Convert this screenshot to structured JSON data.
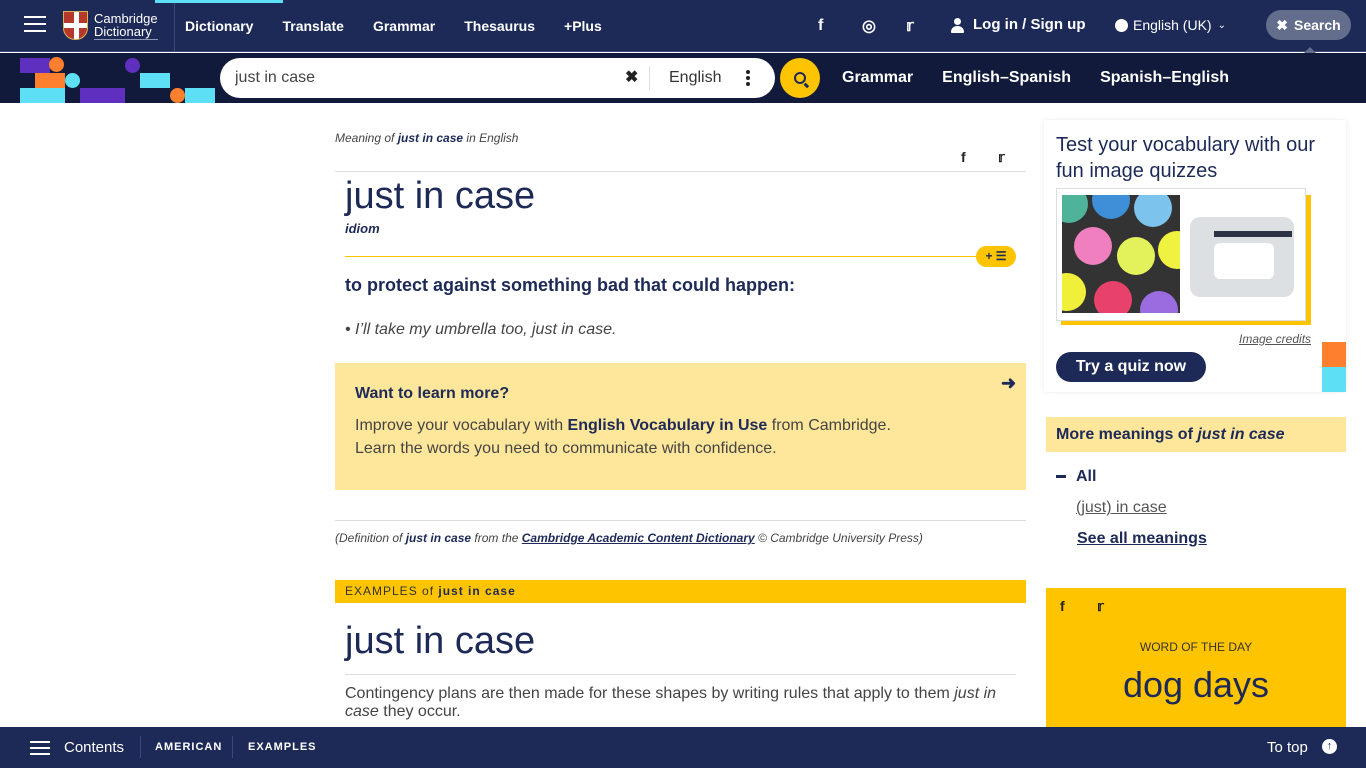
{
  "header": {
    "logo_line1": "Cambridge",
    "logo_line2": "Dictionary",
    "nav": [
      {
        "label": "Dictionary",
        "active": true
      },
      {
        "label": "Translate"
      },
      {
        "label": "Grammar"
      },
      {
        "label": "Thesaurus"
      },
      {
        "label": "+Plus"
      }
    ],
    "social": [
      "facebook-icon",
      "instagram-icon",
      "twitter-icon"
    ],
    "login_label": "Log in / Sign up",
    "language_label": "English (UK)",
    "search_toggle_label": "Search"
  },
  "searchbar": {
    "query": "just in case",
    "dictionary": "English",
    "sub_nav": [
      "Grammar",
      "English–Spanish",
      "Spanish–English"
    ]
  },
  "entry": {
    "meaning_of_prefix": "Meaning of ",
    "meaning_of_word": "just in case",
    "meaning_of_suffix": " in English",
    "headword": "just in case",
    "pos": "idiom",
    "add_to_list_label": "+ ☰",
    "definition": "to protect against something bad that could happen:",
    "example": "I’ll take my umbrella too, just in case.",
    "learn_more": {
      "title": "Want to learn more?",
      "line1_prefix": "Improve your vocabulary with ",
      "line1_bold": "English Vocabulary in Use",
      "line1_suffix": " from Cambridge.",
      "line2": "Learn the words you need to communicate with confidence."
    },
    "source": {
      "prefix": "(Definition of ",
      "word": "just in case",
      "middle": " from the ",
      "link": "Cambridge Academic Content Dictionary",
      "suffix": " © Cambridge University Press)"
    },
    "examples_bar_prefix": "EXAMPLES of ",
    "examples_bar_word": "just in case",
    "examples_headword": "just in case",
    "example_sentence_prefix": "Contingency plans are then made for these shapes by writing rules that apply to them ",
    "example_sentence_italic": "just in case",
    "example_sentence_suffix": " they occur."
  },
  "sidebar": {
    "quiz_title": "Test your vocabulary with our fun image quizzes",
    "image_credits": "Image credits",
    "quiz_button": "Try a quiz now",
    "more_meanings_prefix": "More meanings of ",
    "more_meanings_word": "just in case",
    "all_label": "All",
    "meaning_link": "(just) in case",
    "see_all": "See all meanings",
    "wotd_label": "WORD OF THE DAY",
    "wotd_word": "dog days"
  },
  "footer": {
    "contents_label": "Contents",
    "tabs": [
      "AMERICAN",
      "EXAMPLES"
    ],
    "to_top_label": "To top"
  },
  "colors": {
    "navy": "#1d2a57",
    "yellow": "#fec400",
    "light_yellow": "#fee69a",
    "cyan": "#5de0f5",
    "orange": "#fe7f2d",
    "purple": "#5f2fbf"
  }
}
